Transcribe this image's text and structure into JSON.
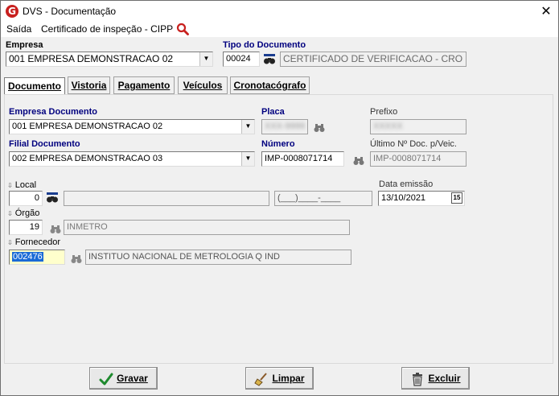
{
  "window": {
    "title": "DVS - Documentação",
    "close_glyph": "✕",
    "app_icon_letter": "G"
  },
  "menu": {
    "items": [
      "Saída",
      "Certificado de inspeção - CIPP"
    ]
  },
  "header": {
    "empresa_label": "Empresa",
    "empresa_value": "001 EMPRESA DEMONSTRACAO 02",
    "tipo_label": "Tipo do Documento",
    "tipo_code": "00024",
    "tipo_desc": "CERTIFICADO DE VERIFICACAO - CRO"
  },
  "tabs": [
    {
      "label": "Documento",
      "active": true
    },
    {
      "label": "Vistoria",
      "active": false
    },
    {
      "label": "Pagamento",
      "active": false
    },
    {
      "label": "Veículos",
      "active": false
    },
    {
      "label": "Cronotacógrafo",
      "active": false
    }
  ],
  "documento": {
    "empresa_doc_label": "Empresa Documento",
    "empresa_doc_value": "001 EMPRESA DEMONSTRACAO 02",
    "placa_label": "Placa",
    "placa_value": "XXX-9999",
    "prefixo_label": "Prefixo",
    "prefixo_value": "XXXXX",
    "filial_label": "Filial Documento",
    "filial_value": "002 EMPRESA DEMONSTRACAO 03",
    "numero_label": "Número",
    "numero_value": "IMP-0008071714",
    "ultimo_label": "Último Nº Doc. p/Veic.",
    "ultimo_value": "IMP-0008071714",
    "local_label": "Local",
    "local_value": "0",
    "local_desc": "",
    "local_phone": "(___)____-____",
    "data_label": "Data emissão",
    "data_value": "13/10/2021",
    "orgao_label": "Órgão",
    "orgao_value": "19",
    "orgao_desc": "INMETRO",
    "fornecedor_label": "Fornecedor",
    "fornecedor_value": "002476",
    "fornecedor_desc": "INSTITUO NACIONAL DE METROLOGIA Q IND"
  },
  "buttons": {
    "gravar": "Gravar",
    "limpar": "Limpar",
    "excluir": "Excluir"
  },
  "colors": {
    "label_blue": "#00007f",
    "selection": "#1a6ad6",
    "accent_red": "#c8201e"
  }
}
